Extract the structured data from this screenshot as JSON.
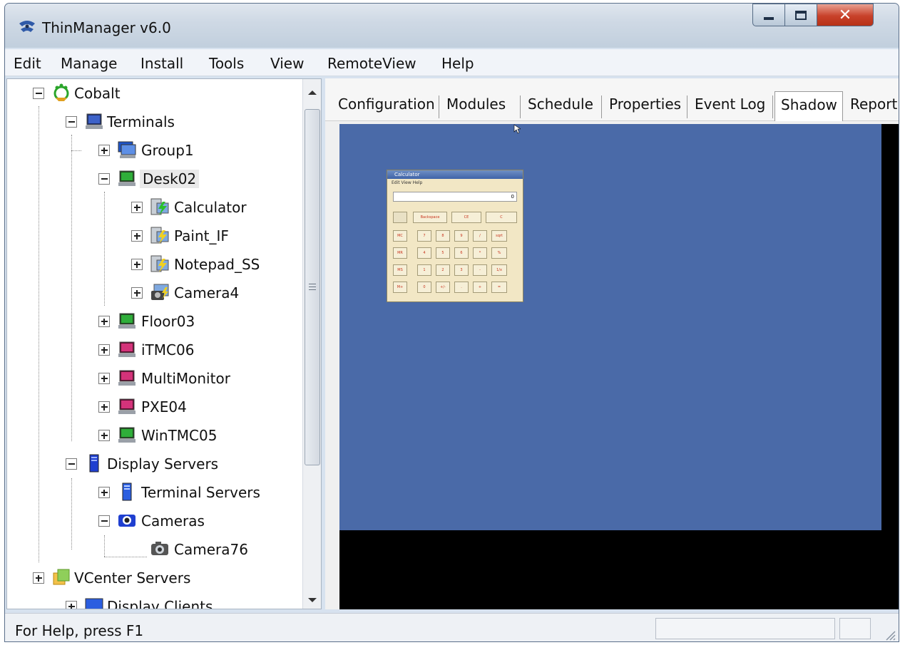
{
  "window": {
    "title": "ThinManager v6.0"
  },
  "menu": {
    "items": [
      "Edit",
      "Manage",
      "Install",
      "Tools",
      "View",
      "RemoteView",
      "Help"
    ]
  },
  "tree": {
    "root": "Cobalt",
    "terminals": "Terminals",
    "group1": "Group1",
    "desk02": "Desk02",
    "calculator": "Calculator",
    "paint": "Paint_IF",
    "notepad": "Notepad_SS",
    "camera4": "Camera4",
    "floor03": "Floor03",
    "itmc06": "iTMC06",
    "multimonitor": "MultiMonitor",
    "pxe04": "PXE04",
    "wintmc05": "WinTMC05",
    "display_servers": "Display Servers",
    "terminal_servers": "Terminal Servers",
    "cameras": "Cameras",
    "camera76": "Camera76",
    "vcenter": "VCenter Servers",
    "display_clients": "Display Clients"
  },
  "tabs": [
    "Configuration",
    "Modules",
    "Schedule",
    "Properties",
    "Event Log",
    "Shadow",
    "Report"
  ],
  "active_tab": "Shadow",
  "calculator": {
    "title": "Calculator",
    "menu": "Edit  View  Help",
    "display": "0",
    "buttons_row1": [
      "Backspace",
      "CE",
      "C"
    ],
    "memory": [
      "MC",
      "MR",
      "MS",
      "M+"
    ],
    "keys": [
      [
        "7",
        "8",
        "9",
        "/",
        "sqrt"
      ],
      [
        "4",
        "5",
        "6",
        "*",
        "%"
      ],
      [
        "1",
        "2",
        "3",
        "-",
        "1/x"
      ],
      [
        "0",
        "+/-",
        ".",
        "+",
        "="
      ]
    ]
  },
  "status": {
    "help": "For Help, press F1"
  },
  "colors": {
    "desktop": "#4a6aa8",
    "shadow_bg": "#000000",
    "close_button": "#c8412a"
  }
}
